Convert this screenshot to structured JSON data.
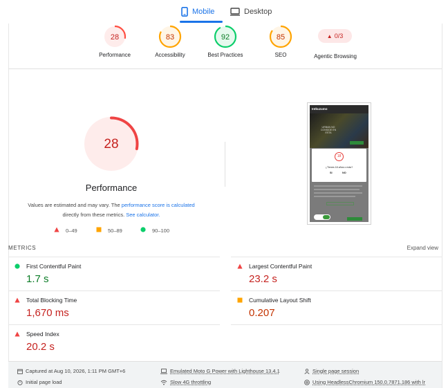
{
  "tabs": {
    "mobile": "Mobile",
    "desktop": "Desktop"
  },
  "categories": [
    {
      "label": "Performance",
      "score": "28",
      "level": "fail",
      "fraction": 0.28
    },
    {
      "label": "Accessibility",
      "score": "83",
      "level": "average",
      "fraction": 0.83
    },
    {
      "label": "Best Practices",
      "score": "92",
      "level": "pass",
      "fraction": 0.92
    },
    {
      "label": "SEO",
      "score": "85",
      "level": "average",
      "fraction": 0.85
    }
  ],
  "agentic": {
    "badge": "0/3",
    "label": "Agentic Browsing"
  },
  "main": {
    "score": "28",
    "fraction": 0.28,
    "title": "Performance",
    "note_1": "Values are estimated and may vary. The",
    "note_link_1": "performance score is calculated",
    "note_2": "directly from these metrics.",
    "note_link_2": "See calculator."
  },
  "legend": {
    "fail": "0–49",
    "average": "50–89",
    "pass": "90–100"
  },
  "metrics_header": "METRICS",
  "expand_view": "Expand view",
  "metrics": [
    {
      "name": "First Contentful Paint",
      "value": "1.7 s",
      "level": "pass"
    },
    {
      "name": "Largest Contentful Paint",
      "value": "23.2 s",
      "level": "fail"
    },
    {
      "name": "Total Blocking Time",
      "value": "1,670 ms",
      "level": "fail"
    },
    {
      "name": "Cumulative Layout Shift",
      "value": "0.207",
      "level": "average"
    },
    {
      "name": "Speed Index",
      "value": "20.2 s",
      "level": "fail"
    }
  ],
  "footer": {
    "captured": "Captured at Aug 10, 2026, 1:11 PM GMT+6",
    "initial_load": "Initial page load",
    "device": "Emulated Moto G Power with Lighthouse 13.4.1",
    "throttling": "Slow 4G throttling",
    "session": "Single page session",
    "browser": "Using HeadlessChromium 150.0.7871.186 with lr"
  },
  "screenshot": {
    "brand": "Intkuzumo",
    "hero": "URBAN NO CONSIDE EN ESTA",
    "modal_score": "18",
    "question": "¿Tienes 18 años o más?",
    "yes": "SI",
    "no": "NO"
  },
  "colors": {
    "fail": "#ff4e42",
    "average": "#ffa400",
    "pass": "#0cce6b",
    "accent": "#1a73e8"
  }
}
